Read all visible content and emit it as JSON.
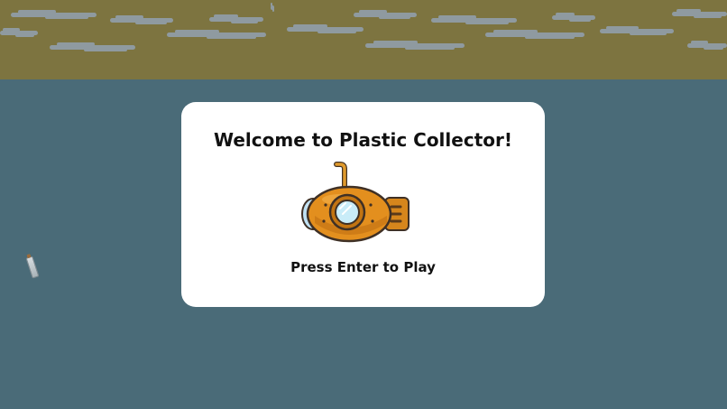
{
  "game": {
    "title": "Welcome to Plastic Collector!",
    "prompt": "Press Enter to Play",
    "player_icon": "submarine-icon",
    "colors": {
      "sky": "#7d7440",
      "sea": "#4a6b78",
      "cloud": "#8f9aa0",
      "dialog": "#ffffff",
      "submarine": "#e38f1e"
    }
  }
}
